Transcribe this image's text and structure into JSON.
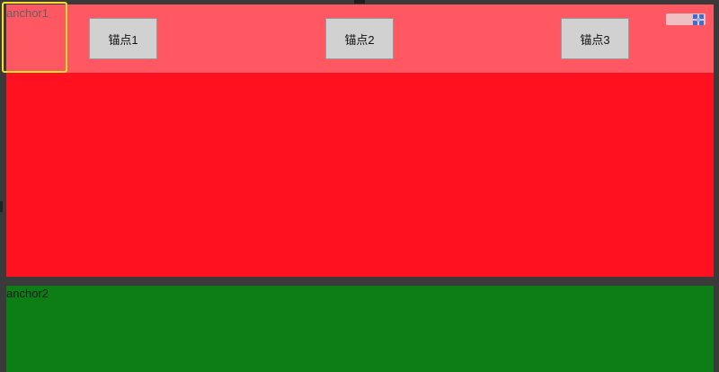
{
  "sections": [
    {
      "label": "anchor1",
      "color": "#ff111f"
    },
    {
      "label": "anchor2",
      "color": "#0d7d16"
    }
  ],
  "nav": {
    "buttons": [
      {
        "label": "锚点1"
      },
      {
        "label": "锚点2"
      },
      {
        "label": "锚点3"
      }
    ],
    "overlay_color": "rgba(255,255,255,0.3)"
  },
  "corner_widget": {
    "icon": "grid-icon"
  },
  "focus_ring": {
    "color": "#f5e12a"
  }
}
